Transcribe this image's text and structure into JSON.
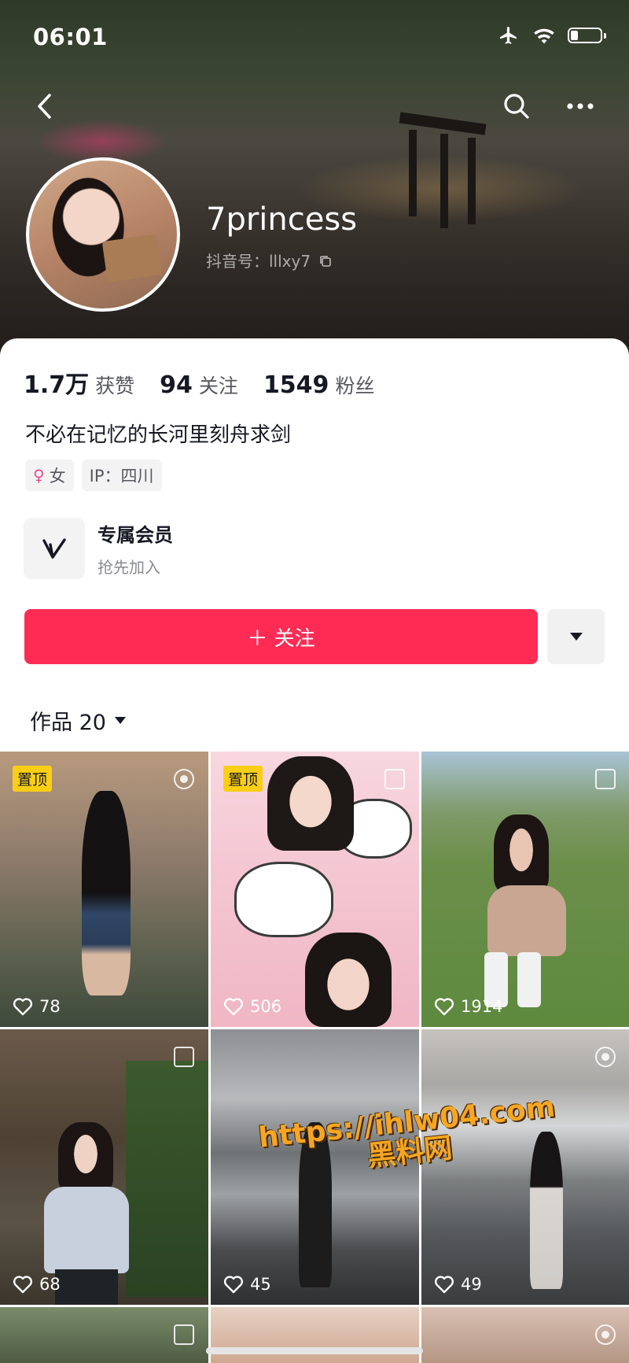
{
  "status_bar": {
    "time": "06:01"
  },
  "profile": {
    "username": "7princess",
    "douyin_id": "抖音号：lllxy7",
    "stats": [
      {
        "value": "1.7万",
        "label": "获赞"
      },
      {
        "value": "94",
        "label": "关注"
      },
      {
        "value": "1549",
        "label": "粉丝"
      }
    ],
    "bio": "不必在记忆的长河里刻舟求剑",
    "tags": {
      "gender": "女",
      "ip": "IP：四川"
    },
    "member": {
      "title": "专属会员",
      "subtitle": "抢先加入"
    },
    "follow_label": "＋ 关注",
    "works_tab": "作品 20"
  },
  "videos": [
    {
      "likes": "78",
      "pinned": true,
      "pin_label": "置顶"
    },
    {
      "likes": "506",
      "pinned": true,
      "pin_label": "置顶"
    },
    {
      "likes": "1914",
      "pinned": false
    },
    {
      "likes": "68",
      "pinned": false
    },
    {
      "likes": "45",
      "pinned": false
    },
    {
      "likes": "49",
      "pinned": false
    }
  ],
  "watermark": {
    "line1": "https://ihlw04.com",
    "line2": "黑料网"
  },
  "colors": {
    "accent": "#fe2c55",
    "pin": "#face15"
  }
}
